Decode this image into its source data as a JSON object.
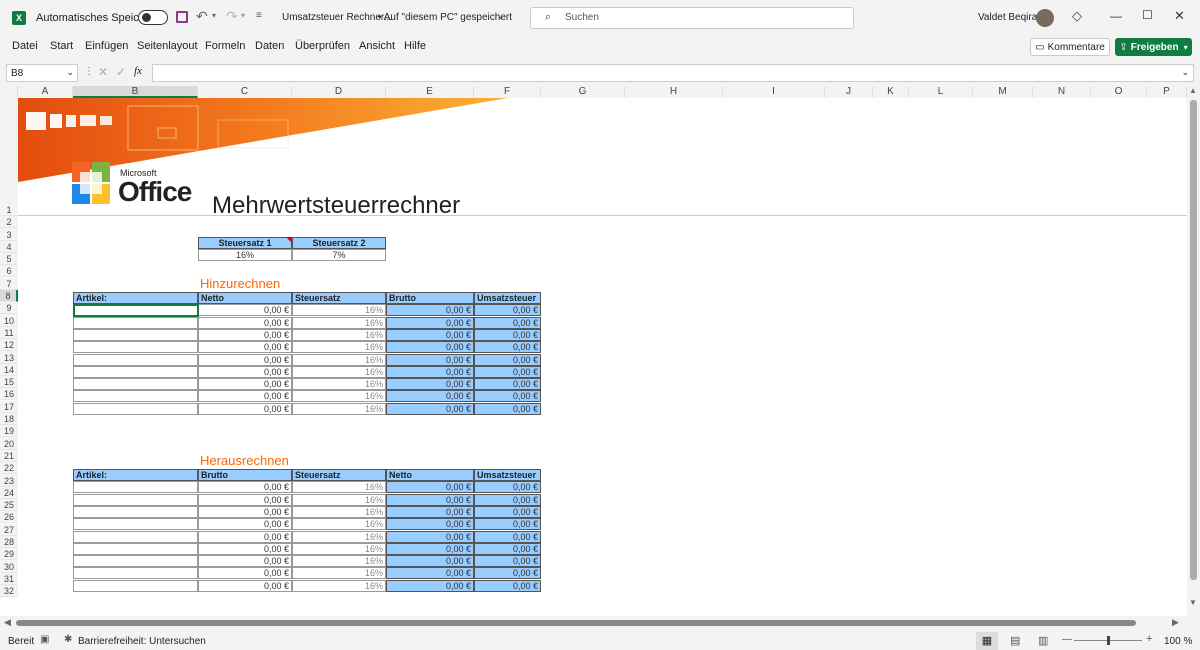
{
  "titlebar": {
    "autosave_label": "Automatisches Speichern",
    "doc_title": "Umsatzsteuer Rechner...",
    "saved_status": "• Auf \"diesem PC\" gespeichert",
    "search_placeholder": "Suchen",
    "user_name": "Valdet Beqiraj"
  },
  "ribbon": {
    "tabs": [
      "Datei",
      "Start",
      "Einfügen",
      "Seitenlayout",
      "Formeln",
      "Daten",
      "Überprüfen",
      "Ansicht",
      "Hilfe"
    ],
    "comments_label": "Kommentare",
    "share_label": "Freigeben"
  },
  "formulabar": {
    "name_box": "B8",
    "fx": "fx",
    "formula": ""
  },
  "columns": [
    "A",
    "B",
    "C",
    "D",
    "E",
    "F",
    "G",
    "H",
    "I",
    "J",
    "K",
    "L",
    "M",
    "N",
    "O",
    "P"
  ],
  "rows": [
    "1",
    "2",
    "3",
    "4",
    "5",
    "6",
    "7",
    "8",
    "9",
    "10",
    "11",
    "12",
    "13",
    "14",
    "15",
    "16",
    "17",
    "18",
    "19",
    "20",
    "21",
    "22",
    "23",
    "24",
    "25",
    "26",
    "27",
    "28",
    "29",
    "30",
    "31",
    "32"
  ],
  "banner": {
    "brand_small": "Microsoft",
    "brand": "Office",
    "title": "Mehrwertsteuerrechner"
  },
  "tax_rates": {
    "headers": [
      "Steuersatz 1",
      "Steuersatz 2"
    ],
    "values": [
      "16%",
      "7%"
    ]
  },
  "add_section": {
    "title": "Hinzurechnen",
    "headers": [
      "Artikel:",
      "Netto",
      "Steuersatz",
      "Brutto",
      "Umsatzsteuer"
    ],
    "rows": [
      [
        "",
        "0,00 €",
        "16%",
        "0,00 €",
        "0,00 €"
      ],
      [
        "",
        "0,00 €",
        "16%",
        "0,00 €",
        "0,00 €"
      ],
      [
        "",
        "0,00 €",
        "16%",
        "0,00 €",
        "0,00 €"
      ],
      [
        "",
        "0,00 €",
        "16%",
        "0,00 €",
        "0,00 €"
      ],
      [
        "",
        "0,00 €",
        "16%",
        "0,00 €",
        "0,00 €"
      ],
      [
        "",
        "0,00 €",
        "16%",
        "0,00 €",
        "0,00 €"
      ],
      [
        "",
        "0,00 €",
        "16%",
        "0,00 €",
        "0,00 €"
      ],
      [
        "",
        "0,00 €",
        "16%",
        "0,00 €",
        "0,00 €"
      ],
      [
        "",
        "0,00 €",
        "16%",
        "0,00 €",
        "0,00 €"
      ]
    ]
  },
  "remove_section": {
    "title": "Herausrechnen",
    "headers": [
      "Artikel:",
      "Brutto",
      "Steuersatz",
      "Netto",
      "Umsatzsteuer"
    ],
    "rows": [
      [
        "",
        "0,00 €",
        "16%",
        "0,00 €",
        "0,00 €"
      ],
      [
        "",
        "0,00 €",
        "16%",
        "0,00 €",
        "0,00 €"
      ],
      [
        "",
        "0,00 €",
        "16%",
        "0,00 €",
        "0,00 €"
      ],
      [
        "",
        "0,00 €",
        "16%",
        "0,00 €",
        "0,00 €"
      ],
      [
        "",
        "0,00 €",
        "16%",
        "0,00 €",
        "0,00 €"
      ],
      [
        "",
        "0,00 €",
        "16%",
        "0,00 €",
        "0,00 €"
      ],
      [
        "",
        "0,00 €",
        "16%",
        "0,00 €",
        "0,00 €"
      ],
      [
        "",
        "0,00 €",
        "16%",
        "0,00 €",
        "0,00 €"
      ],
      [
        "",
        "0,00 €",
        "16%",
        "0,00 €",
        "0,00 €"
      ]
    ]
  },
  "statusbar": {
    "ready": "Bereit",
    "accessibility": "Barrierefreiheit: Untersuchen",
    "zoom": "100 %"
  },
  "colors": {
    "accent_green": "#107c41",
    "header_blue": "#99ccff",
    "section_orange": "#ff6600"
  }
}
